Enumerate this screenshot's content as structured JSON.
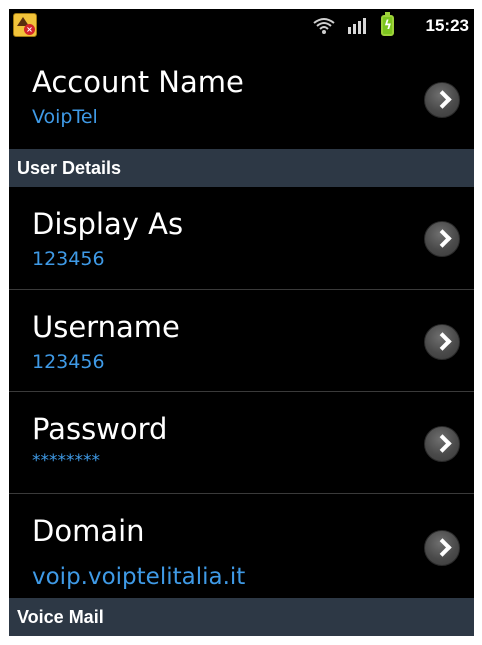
{
  "status_bar": {
    "time": "15:23",
    "icons": [
      "app-warning-icon",
      "wifi-icon",
      "signal-icon",
      "battery-charging-icon"
    ]
  },
  "account": {
    "title": "Account Name",
    "value": "VoipTel"
  },
  "sections": {
    "user_details": "User Details",
    "voice_mail": "Voice Mail"
  },
  "fields": {
    "display_as": {
      "title": "Display As",
      "value": "123456"
    },
    "username": {
      "title": "Username",
      "value": "123456"
    },
    "password": {
      "title": "Password",
      "value": "********"
    },
    "domain": {
      "title": "Domain",
      "value": "voip.voiptelitalia.it"
    }
  },
  "colors": {
    "background": "#000000",
    "value_text": "#3f9ae6",
    "section_header": "#2d3845",
    "divider": "#3a3a3a"
  }
}
